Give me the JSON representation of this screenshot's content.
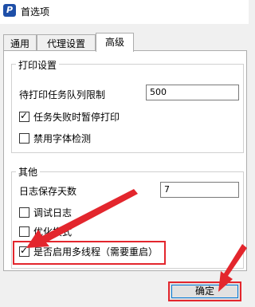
{
  "window": {
    "title": "首选项",
    "icon": "app-icon"
  },
  "tabs": [
    {
      "label": "通用",
      "active": false
    },
    {
      "label": "代理设置",
      "active": false
    },
    {
      "label": "高级",
      "active": true
    }
  ],
  "print_settings": {
    "group_title": "打印设置",
    "queue_limit_label": "待打印任务队列限制",
    "queue_limit_value": "500",
    "pause_on_fail_label": "任务失败时暂停打印",
    "pause_on_fail_checked": true,
    "disable_font_check_label": "禁用字体检测",
    "disable_font_check_checked": false
  },
  "other": {
    "group_title": "其他",
    "log_days_label": "日志保存天数",
    "log_days_value": "7",
    "debug_log_label": "调试日志",
    "debug_log_checked": false,
    "optimize_label": "优化模式",
    "optimize_checked": false,
    "multithread_label": "是否启用多线程（需要重启）",
    "multithread_checked": true
  },
  "buttons": {
    "ok_label": "确定"
  },
  "colors": {
    "annotation_red": "#e3262d",
    "focus_blue": "#0078d7"
  }
}
